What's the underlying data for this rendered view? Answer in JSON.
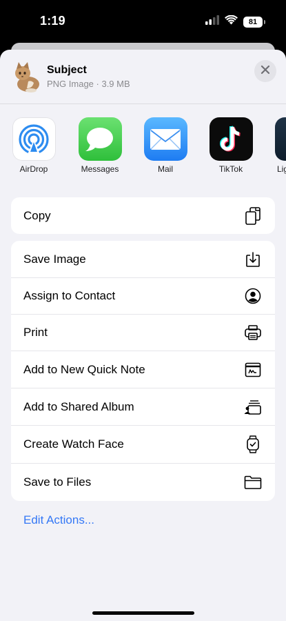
{
  "status_bar": {
    "time": "1:19",
    "battery": "81"
  },
  "header": {
    "title": "Subject",
    "subtitle": "PNG Image · 3.9 MB"
  },
  "apps": [
    {
      "label": "AirDrop",
      "icon": "airdrop-icon"
    },
    {
      "label": "Messages",
      "icon": "messages-icon"
    },
    {
      "label": "Mail",
      "icon": "mail-icon"
    },
    {
      "label": "TikTok",
      "icon": "tiktok-icon"
    },
    {
      "label": "Lig",
      "icon": "app-icon"
    }
  ],
  "actions": {
    "copy": "Copy",
    "list": [
      {
        "label": "Save Image",
        "icon": "save-image-icon"
      },
      {
        "label": "Assign to Contact",
        "icon": "contact-icon"
      },
      {
        "label": "Print",
        "icon": "printer-icon"
      },
      {
        "label": "Add to New Quick Note",
        "icon": "quick-note-icon"
      },
      {
        "label": "Add to Shared Album",
        "icon": "shared-album-icon"
      },
      {
        "label": "Create Watch Face",
        "icon": "watch-icon"
      },
      {
        "label": "Save to Files",
        "icon": "folder-icon"
      }
    ]
  },
  "edit_actions": "Edit Actions...",
  "colors": {
    "accent": "#3478f6",
    "sheet_bg": "#f2f2f7"
  }
}
